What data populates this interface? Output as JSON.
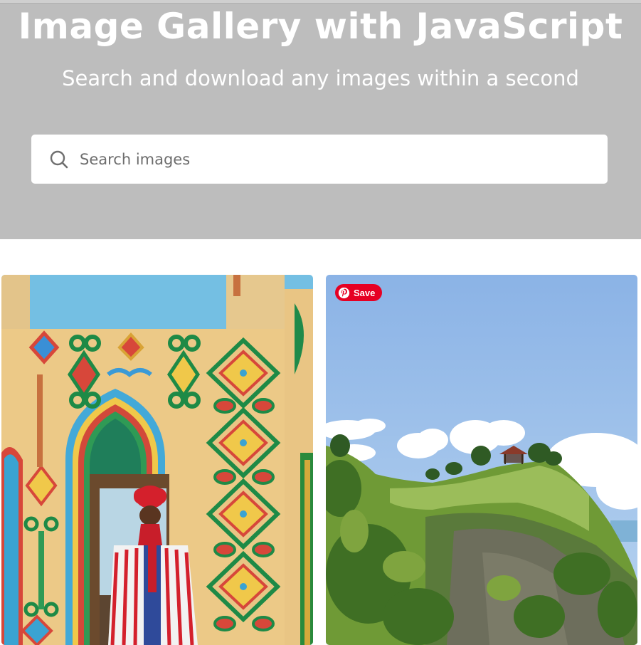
{
  "hero": {
    "title": "Image Gallery with JavaScript",
    "subtitle": "Search and download any images within a second"
  },
  "search": {
    "placeholder": "Search images",
    "value": "",
    "icon": "search-icon"
  },
  "gallery": {
    "images": [
      {
        "subject": "Man in red turban and striped robe before a colorful ornamented doorway"
      },
      {
        "subject": "Green cliff with gazebo under blue sky"
      }
    ],
    "pin_save_label": "Save"
  },
  "colors": {
    "hero_bg": "#bdbdbd",
    "pinterest_red": "#e60023"
  }
}
